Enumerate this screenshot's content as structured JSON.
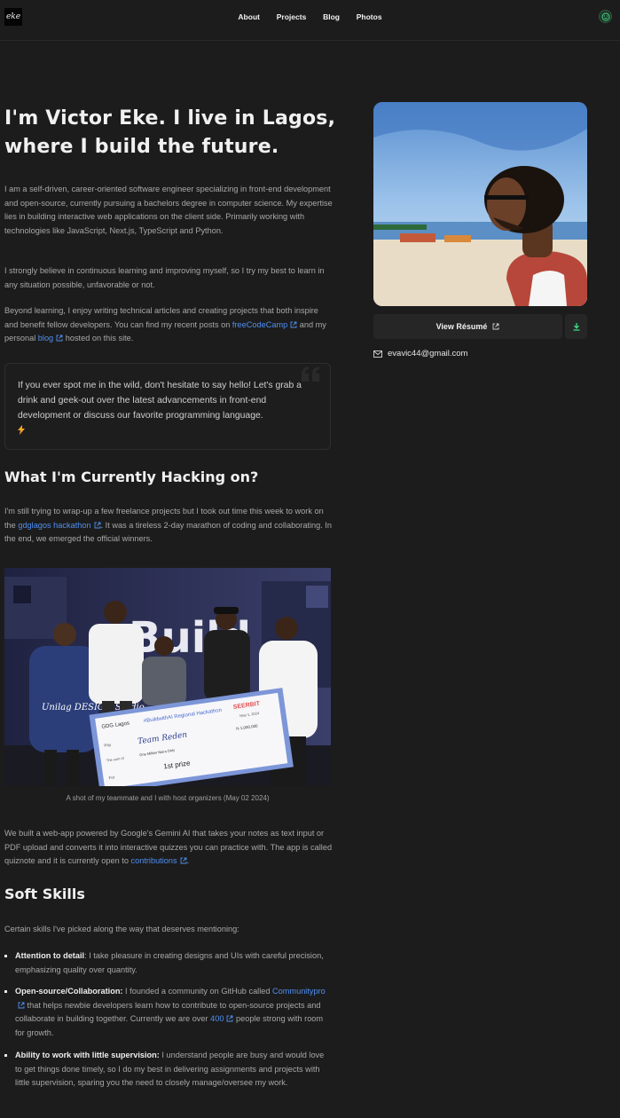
{
  "header": {
    "logo_text": "eke",
    "nav": [
      "About",
      "Projects",
      "Blog",
      "Photos"
    ],
    "theme_icon": "smile-face-icon"
  },
  "intro": {
    "title": "I'm Victor Eke. I live in Lagos, where I build the future.",
    "p1": "I am a self-driven, career-oriented software engineer specializing in front-end development and open-source, currently pursuing a bachelors degree in computer science. My expertise lies in building interactive web applications on the client side. Primarily working with technologies like JavaScript, Next.js, TypeScript and Python.",
    "p2": "I strongly believe in continuous learning and improving myself, so I try my best to learn in any situation possible, unfavorable or not.",
    "p3_before": "Beyond learning, I enjoy writing technical articles and creating projects that both inspire and benefit fellow developers. You can find my recent posts on ",
    "p3_link1": "freeCodeCamp",
    "p3_middle": " and my personal ",
    "p3_link2": "blog",
    "p3_after": " hosted on this site.",
    "quote": "If you ever spot me in the wild, don't hesitate to say hello! Let's grab a drink and geek-out over the latest advancements in front-end development or discuss our favorite programming language."
  },
  "hacking": {
    "title": "What I'm Currently Hacking on?",
    "p_before": "I'm still trying to wrap-up a few freelance projects but I took out time this week to work on the ",
    "p_link": "gdglagos hackathon",
    "p_after": ". It was a tireless 2-day marathon of coding and collaborating. In the end, we emerged the official winners.",
    "caption": "A shot of my teammate and I with host organizers (May 02 2024)",
    "p2_before": "We built a web-app powered by Google's Gemini AI that takes your notes as text input or PDF upload and converts it into interactive quizzes you can practice with. The app is called quiznote and it is currently open to ",
    "p2_link": "contributions",
    "p2_after": "."
  },
  "photo_text": {
    "banner": "Build",
    "shirt": "Unilag DESIGN Studio",
    "brand": "SEERBIT",
    "gdg": "GDG Lagos",
    "hackathon": "#BuildwithAI Regional Hackathon",
    "date": "May 1, 2024",
    "pay": "Pay",
    "payee": "Team Reden",
    "amount": "N 1,000,000",
    "sum_label": "The sum of",
    "sum_words": "One Million Naira Only",
    "for": "For",
    "prize": "1st prize"
  },
  "skills": {
    "title": "Soft Skills",
    "intro": "Certain skills I've picked along the way that deserves mentioning:",
    "s1_title": "Attention to detail",
    "s1_text": ": I take pleasure in creating designs and UIs with careful precision, emphasizing quality over quantity.",
    "s2_title": "Open-source/Collaboration:",
    "s2_before": " I founded a community on GitHub called ",
    "s2_link1": "Communitypro",
    "s2_middle": " that helps newbie developers learn how to contribute to open-source projects and collaborate in building together. Currently we are over ",
    "s2_link2": "400",
    "s2_after": " people strong with room for growth.",
    "s3_title": "Ability to work with little supervision:",
    "s3_text": " I understand people are busy and would love to get things done timely, so I do my best in delivering assignments and projects with little supervision, sparing you the need to closely manage/oversee my work."
  },
  "sidebar": {
    "resume_label": "View Résumé",
    "email": "evavic44@gmail.com"
  },
  "colors": {
    "background": "#1c1c1c",
    "link": "#4f8ff0",
    "accent_green": "#3ddc84",
    "lightning": "#f5a623"
  }
}
